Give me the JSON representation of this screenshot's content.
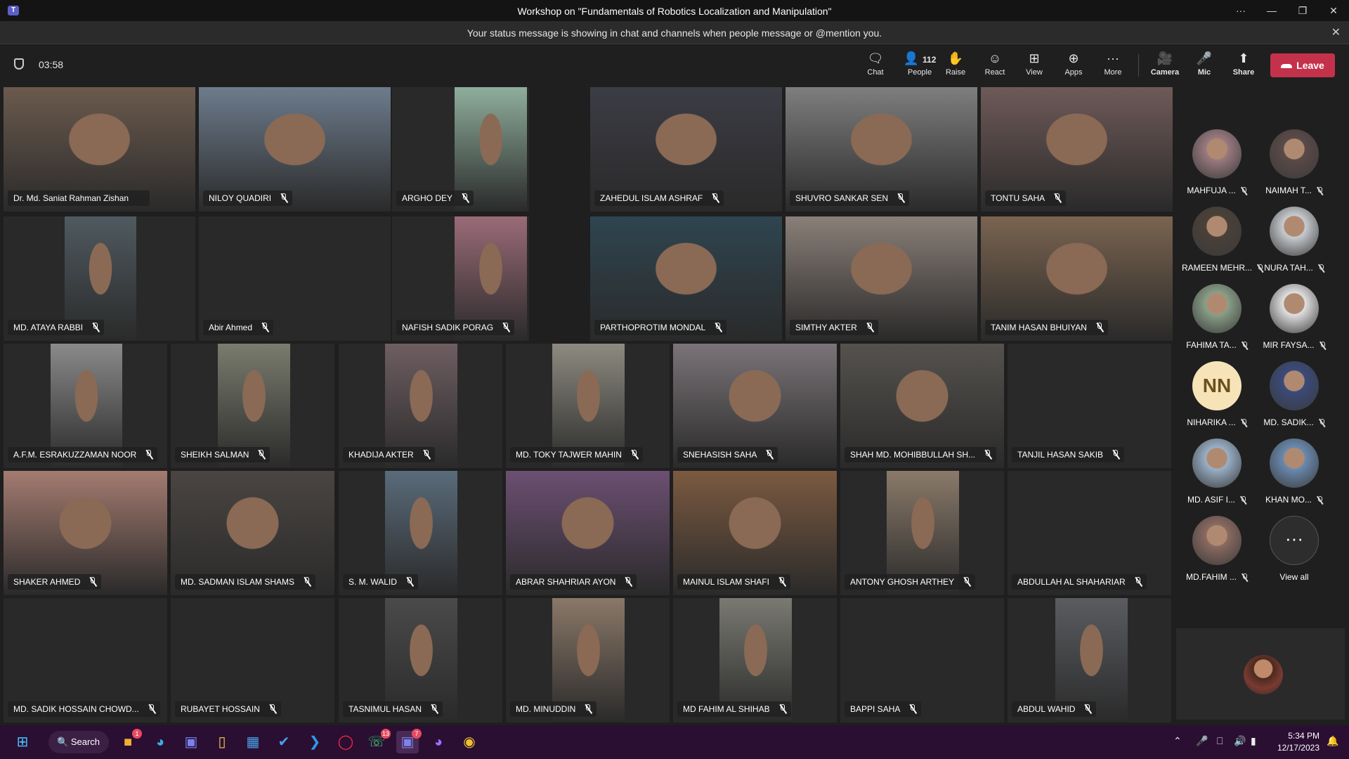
{
  "window": {
    "title": "Workshop on \"Fundamentals of Robotics Localization and Manipulation\"",
    "controls": [
      "···",
      "—",
      "❐",
      "✕"
    ]
  },
  "banner": {
    "message": "Your status message is showing in chat and channels when people message or @mention you.",
    "close": "✕"
  },
  "toolbar": {
    "timer": "03:58",
    "chat": "Chat",
    "people": "People",
    "people_count": "112",
    "raise": "Raise",
    "react": "React",
    "view": "View",
    "apps": "Apps",
    "more": "More",
    "camera": "Camera",
    "mic": "Mic",
    "share": "Share",
    "leave": "Leave"
  },
  "participants": [
    {
      "name": "Dr. Md. Saniat Rahman Zishan",
      "muted": false,
      "video": true,
      "tone": "#6b5a4d"
    },
    {
      "name": "NILOY QUADIRI",
      "muted": true,
      "video": true,
      "tone": "#6d7c8c"
    },
    {
      "name": "ARGHO DEY",
      "muted": true,
      "video": true,
      "tone": "#8fae9c"
    },
    {
      "name": "ZAHEDUL ISLAM ASHRAF",
      "muted": true,
      "video": true,
      "tone": "#3c3c45"
    },
    {
      "name": "SHUVRO SANKAR SEN",
      "muted": true,
      "video": true,
      "tone": "#7e7e7e"
    },
    {
      "name": "TONTU SAHA",
      "muted": true,
      "video": true,
      "tone": "#6e5a58"
    },
    {
      "name": "MD. ATAYA RABBI",
      "muted": true,
      "video": true,
      "tone": "#4f5a60"
    },
    {
      "name": "Abir Ahmed",
      "muted": true,
      "video": false,
      "tone": "#292929"
    },
    {
      "name": "NAFISH SADIK PORAG",
      "muted": true,
      "video": true,
      "tone": "#9a6b78"
    },
    {
      "name": "PARTHOPROTIM MONDAL",
      "muted": true,
      "video": true,
      "tone": "#2f4550"
    },
    {
      "name": "SIMTHY AKTER",
      "muted": true,
      "video": true,
      "tone": "#8a7f78"
    },
    {
      "name": "TANIM HASAN BHUIYAN",
      "muted": true,
      "video": true,
      "tone": "#7a6450"
    },
    {
      "name": "A.F.M. ESRAKUZZAMAN NOOR",
      "muted": true,
      "video": true,
      "tone": "#8a8a8a"
    },
    {
      "name": "SHEIKH SALMAN",
      "muted": true,
      "video": true,
      "tone": "#7a7c6e"
    },
    {
      "name": "KHADIJA AKTER",
      "muted": true,
      "video": true,
      "tone": "#6e5e62"
    },
    {
      "name": "MD. TOKY TAJWER MAHIN",
      "muted": true,
      "video": true,
      "tone": "#8d8b80"
    },
    {
      "name": "SNEHASISH SAHA",
      "muted": true,
      "video": true,
      "tone": "#7a7478"
    },
    {
      "name": "SHAH MD. MOHIBBULLAH SH...",
      "muted": true,
      "video": true,
      "tone": "#55524e"
    },
    {
      "name": "TANJIL HASAN SAKIB",
      "muted": true,
      "video": false,
      "tone": "#292929"
    },
    {
      "name": "SHAKER AHMED",
      "muted": true,
      "video": true,
      "tone": "#a47b70"
    },
    {
      "name": "MD. SADMAN ISLAM SHAMS",
      "muted": true,
      "video": true,
      "tone": "#4a4542"
    },
    {
      "name": "S. M. WALID",
      "muted": true,
      "video": true,
      "tone": "#5a6b7a"
    },
    {
      "name": "ABRAR SHAHRIAR AYON",
      "muted": true,
      "video": true,
      "tone": "#6c4f72"
    },
    {
      "name": "MAINUL ISLAM SHAFI",
      "muted": true,
      "video": true,
      "tone": "#7b5a40"
    },
    {
      "name": "ANTONY GHOSH ARTHEY",
      "muted": true,
      "video": true,
      "tone": "#8a7a6a"
    },
    {
      "name": "ABDULLAH AL SHAHARIAR",
      "muted": true,
      "video": false,
      "tone": "#292929"
    },
    {
      "name": "MD. SADIK HOSSAIN CHOWD...",
      "muted": true,
      "video": false,
      "tone": "#292929"
    },
    {
      "name": "RUBAYET HOSSAIN",
      "muted": true,
      "video": false,
      "tone": "#292929"
    },
    {
      "name": "TASNIMUL HASAN",
      "muted": true,
      "video": true,
      "tone": "#4a4a4a"
    },
    {
      "name": "MD. MINUDDIN",
      "muted": true,
      "video": true,
      "tone": "#8a7868"
    },
    {
      "name": "MD FAHIM AL SHIHAB",
      "muted": true,
      "video": true,
      "tone": "#7a7a72"
    },
    {
      "name": "BAPPI SAHA",
      "muted": true,
      "video": false,
      "tone": "#292929"
    },
    {
      "name": "ABDUL WAHID",
      "muted": true,
      "video": true,
      "tone": "#5a5c60"
    }
  ],
  "side_participants": [
    {
      "name": "MAHFUJA ...",
      "tone": "#9a7a80"
    },
    {
      "name": "NAIMAH T...",
      "tone": "#5a4a48"
    },
    {
      "name": "RAMEEN MEHR...",
      "tone": "#4a4038"
    },
    {
      "name": "NURA TAH...",
      "tone": "#c8ccd0"
    },
    {
      "name": "FAHIMA TA...",
      "tone": "#8aa088"
    },
    {
      "name": "MIR FAYSA...",
      "tone": "#e0e0e0"
    },
    {
      "name": "NIHARIKA ...",
      "initials": "NN"
    },
    {
      "name": "MD. SADIK...",
      "tone": "#3a4a7a"
    },
    {
      "name": "MD. ASIF I...",
      "tone": "#9ab0c8"
    },
    {
      "name": "KHAN MO...",
      "tone": "#6a8ab0"
    },
    {
      "name": "MD.FAHIM ...",
      "tone": "#8a6a60"
    }
  ],
  "view_all": "View all",
  "view_all_glyph": "···",
  "taskbar": {
    "search": "Search",
    "badges": {
      "notes": "1",
      "whatsapp": "13",
      "teams": "7"
    },
    "time": "5:34 PM",
    "date": "12/17/2023"
  }
}
